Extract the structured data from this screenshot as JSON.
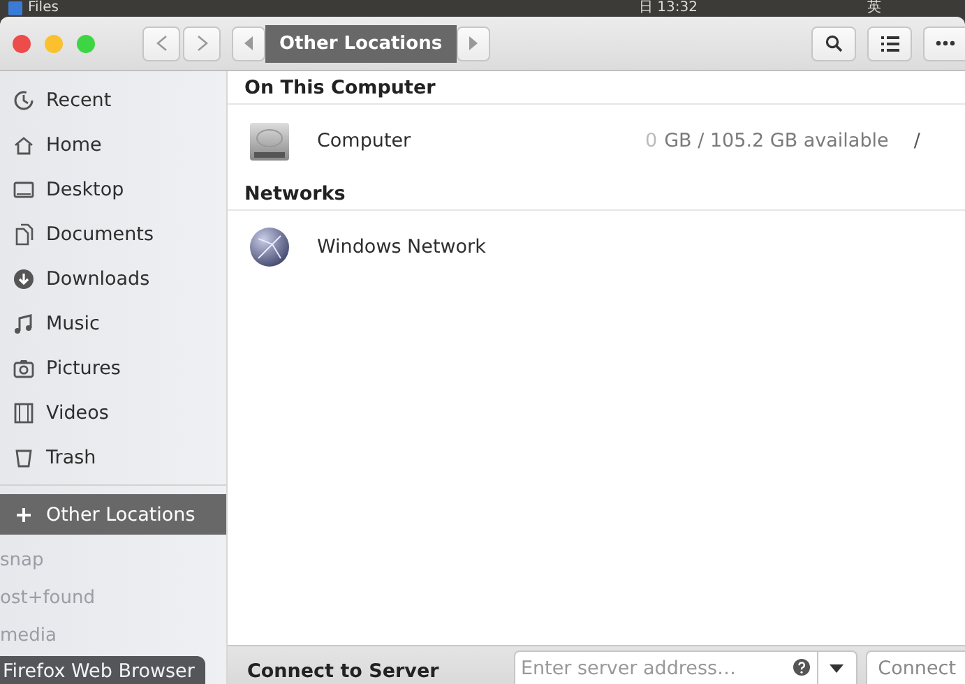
{
  "top_bar": {
    "app": "Files",
    "clock": "日 13:32",
    "indicator": "英"
  },
  "window": {
    "path": {
      "label": "Other Locations"
    }
  },
  "sidebar": {
    "items": [
      {
        "label": "Recent",
        "kind": "recent",
        "selected": false
      },
      {
        "label": "Home",
        "kind": "home",
        "selected": false
      },
      {
        "label": "Desktop",
        "kind": "desktop",
        "selected": false
      },
      {
        "label": "Documents",
        "kind": "documents",
        "selected": false
      },
      {
        "label": "Downloads",
        "kind": "downloads",
        "selected": false
      },
      {
        "label": "Music",
        "kind": "music",
        "selected": false
      },
      {
        "label": "Pictures",
        "kind": "pictures",
        "selected": false
      },
      {
        "label": "Videos",
        "kind": "videos",
        "selected": false
      },
      {
        "label": "Trash",
        "kind": "trash",
        "selected": false
      }
    ],
    "other": {
      "label": "Other Locations",
      "selected": true
    },
    "background_labels": [
      "snap",
      "ost+found",
      "media"
    ],
    "tooltip": "Firefox Web Browser"
  },
  "sections": [
    {
      "title": "On This Computer",
      "rows": [
        {
          "name": "Computer",
          "kind": "drive",
          "used": "0",
          "capacity": "GB / 105.2 GB available",
          "mount": "/"
        }
      ]
    },
    {
      "title": "Networks",
      "rows": [
        {
          "name": "Windows Network",
          "kind": "network"
        }
      ]
    }
  ],
  "connect": {
    "label": "Connect to Server",
    "placeholder": "Enter server address…",
    "button": "Connect"
  }
}
